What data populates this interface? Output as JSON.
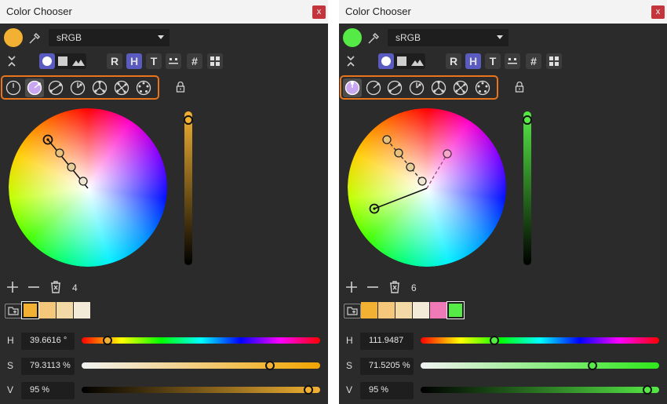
{
  "panels": [
    {
      "title": "Color Chooser",
      "close": "x",
      "current_color": "#f2b132",
      "color_space": "sRGB",
      "harmony_selected": 1,
      "palette_count": "4",
      "palette": [
        "#f2b132",
        "#f4c77a",
        "#f2d9a6",
        "#f3ead8"
      ],
      "palette_selected": 0,
      "vbar_color": "#f2b132",
      "fields": {
        "h_label": "H",
        "s_label": "S",
        "v_label": "V",
        "h": "39.6616 °",
        "s": "79.3113 %",
        "v": "95 %"
      },
      "slider_fraction": {
        "h": 0.11,
        "s": 0.79,
        "v": 0.95
      }
    },
    {
      "title": "Color Chooser",
      "close": "x",
      "current_color": "#55ea45",
      "color_space": "sRGB",
      "harmony_selected": 0,
      "palette_count": "6",
      "palette": [
        "#f2b132",
        "#f4c77a",
        "#f2d9a6",
        "#f3ead8",
        "#f07ab8",
        "#55ea45"
      ],
      "palette_selected": 5,
      "vbar_color": "#55ea45",
      "fields": {
        "h_label": "H",
        "s_label": "S",
        "v_label": "V",
        "h": "111.9487",
        "s": "71.5205 %",
        "v": "95 %"
      },
      "slider_fraction": {
        "h": 0.31,
        "s": 0.72,
        "v": 0.95
      }
    }
  ],
  "toolbar": {
    "r": "R",
    "h": "H",
    "t": "T",
    "hash": "#"
  },
  "icons": [
    "collapse-icon",
    "wheel-icon",
    "square-icon",
    "image-icon",
    "slider-icon",
    "grid-icon",
    "lock-icon",
    "eyedropper-icon",
    "plus-icon",
    "minus-icon",
    "trash-icon",
    "add-palette-icon"
  ]
}
